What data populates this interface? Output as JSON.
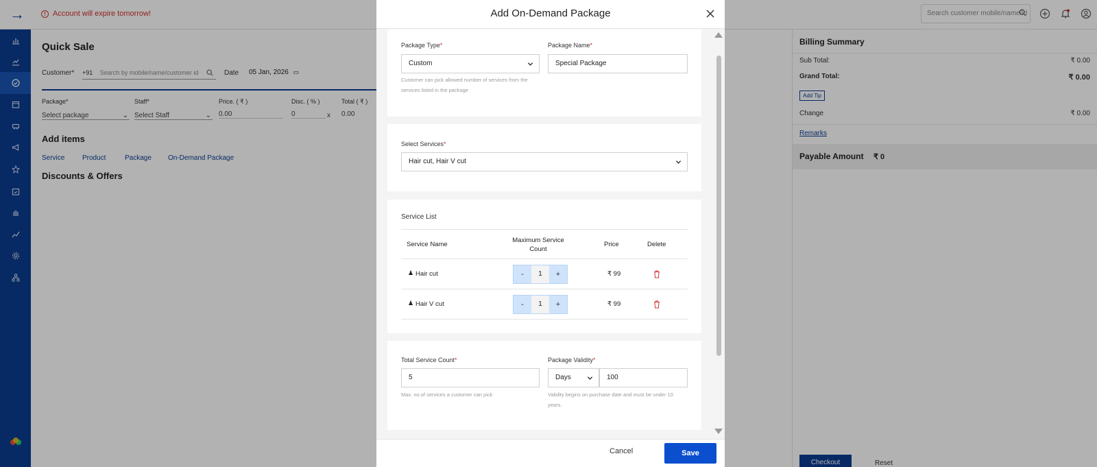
{
  "topbar": {
    "alert": "Account will expire tomorrow!",
    "search_placeholder": "Search customer mobile/name/id"
  },
  "main": {
    "title": "Quick Sale",
    "customer_label": "Customer*",
    "country_code": "+91",
    "customer_placeholder": "Search by mobile/name/customer id",
    "date_label": "Date",
    "date_value": "05 Jan, 2026",
    "columns": {
      "package": "Package*",
      "staff": "Staff*",
      "price": "Price. ( ₹ )",
      "disc": "Disc. ( % )",
      "total": "Total ( ₹ )"
    },
    "values": {
      "package": "Select package",
      "staff": "Select Staff",
      "price": "0.00",
      "disc": "0",
      "x": "x",
      "total": "0.00"
    },
    "add_items_title": "Add items",
    "tabs": [
      "Service",
      "Product",
      "Package",
      "On-Demand Package"
    ],
    "discounts_title": "Discounts & Offers"
  },
  "billing": {
    "title": "Billing Summary",
    "sub_total_label": "Sub Total:",
    "sub_total_value": "₹ 0.00",
    "grand_total_label": "Grand Total:",
    "grand_total_value": "₹ 0.00",
    "add_tip": "Add Tip",
    "change_label": "Change",
    "change_value": "₹ 0.00",
    "remarks": "Remarks",
    "payable_label": "Payable Amount",
    "payable_value": "₹ 0",
    "checkout": "Checkout",
    "reset": "Reset"
  },
  "modal": {
    "title": "Add On-Demand Package",
    "package_type_label": "Package Type",
    "package_type_value": "Custom",
    "package_type_hint_1": "Customer can pick allowed number of services from the",
    "package_type_hint_2": "services listed in the package",
    "package_name_label": "Package Name",
    "package_name_value": "Special Package",
    "select_services_label": "Select Services",
    "select_services_value": "Hair cut, Hair V cut",
    "service_list_title": "Service List",
    "table_headers": {
      "name": "Service Name",
      "max_1": "Maximum Service",
      "max_2": "Count",
      "price": "Price",
      "delete": "Delete"
    },
    "services": [
      {
        "name": "Hair cut",
        "count": "1",
        "price": "₹ 99",
        "minus": "-",
        "plus": "+"
      },
      {
        "name": "Hair V cut",
        "count": "1",
        "price": "₹ 99",
        "minus": "-",
        "plus": "+"
      }
    ],
    "total_count_label": "Total Service Count",
    "total_count_value": "5",
    "total_count_hint": "Max. no.of services a customer can pick",
    "validity_label": "Package Validity",
    "validity_unit": "Days",
    "validity_value": "100",
    "validity_hint_1": "Validity begins on purchase date and must be under 10",
    "validity_hint_2": "years.",
    "required_mark": "*",
    "cancel": "Cancel",
    "save": "Save"
  },
  "colors": {
    "brand": "#0b3d91",
    "primary_button": "#0b4fcf",
    "alert": "#d32f2f",
    "stepper": "#cfe3fb"
  }
}
